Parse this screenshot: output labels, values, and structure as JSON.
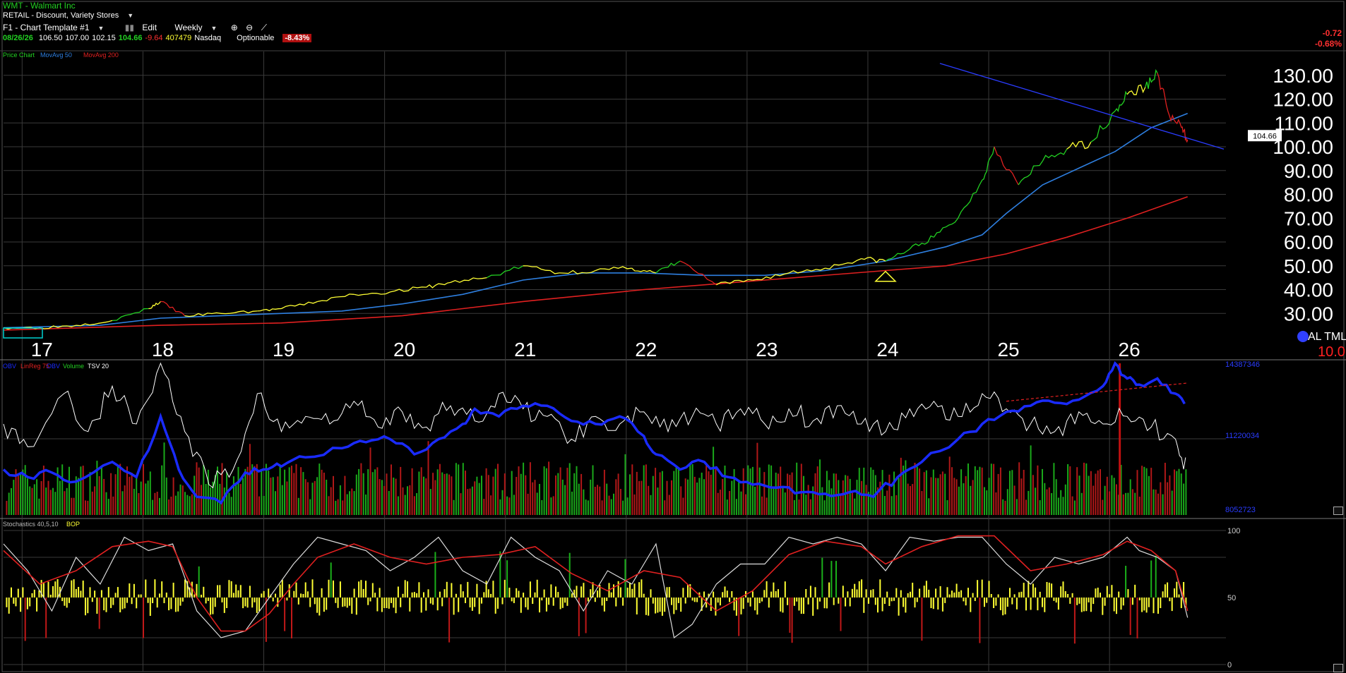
{
  "header": {
    "symbol_line": "WMT - Walmart Inc",
    "industry": "RETAIL - Discount, Variety Stores",
    "template": "F1 - Chart Template #1",
    "edit_label": "Edit",
    "period": "Weekly",
    "quote": {
      "date": "08/26/26",
      "open": "106.50",
      "high": "107.00",
      "low": "102.15",
      "close": "104.66",
      "change": "-9.64",
      "volume": "407479",
      "exchange": "Nasdaq",
      "optionable": "Optionable",
      "pct": "-8.43%"
    },
    "right_change": "-0.72",
    "right_pct": "-0.68%"
  },
  "colors": {
    "price_up": "#22d022",
    "price_down": "#e02020",
    "price_neutral": "#ffff33",
    "ma50": "#2e7fe0",
    "ma200": "#e02020",
    "obv": "#1a2bff",
    "tsv": "#ffffff",
    "stoch_k": "#dddddd",
    "stoch_d": "#e02020"
  },
  "chart_data": [
    {
      "type": "line",
      "panel": "price",
      "legend": [
        "Price Chart",
        "MovAvg 50",
        "MovAvg 200"
      ],
      "ylim": [
        20,
        140
      ],
      "yticks": [
        30,
        40,
        50,
        60,
        70,
        80,
        90,
        100,
        110,
        120,
        130
      ],
      "ytick_labels": [
        "30.00",
        "40.00",
        "50.00",
        "60.00",
        "70.00",
        "80.00",
        "90.00",
        "100.00",
        "110.00",
        "120.00",
        "130.00"
      ],
      "xlim": [
        2016.7,
        2026.8
      ],
      "xticks": [
        2017,
        2018,
        2019,
        2020,
        2021,
        2022,
        2023,
        2024,
        2025,
        2026
      ],
      "xtick_labels": [
        "17",
        "18",
        "19",
        "20",
        "21",
        "22",
        "23",
        "24",
        "25",
        "26"
      ],
      "last_price_label": "104.66",
      "corner_text": [
        "AL TML",
        "10.0"
      ],
      "price_series": {
        "x": [
          2016.7,
          2017.0,
          2017.3,
          2017.6,
          2017.9,
          2018.0,
          2018.2,
          2018.5,
          2018.8,
          2019.0,
          2019.3,
          2019.6,
          2019.9,
          2020.2,
          2020.4,
          2020.7,
          2021.0,
          2021.3,
          2021.6,
          2021.9,
          2022.1,
          2022.3,
          2022.6,
          2022.9,
          2023.2,
          2023.5,
          2023.8,
          2024.0,
          2024.2,
          2024.4,
          2024.6,
          2024.8,
          2024.9,
          2025.1,
          2025.3,
          2025.5,
          2025.7,
          2025.9,
          2026.0,
          2026.15,
          2026.25,
          2026.35,
          2026.45,
          2026.5
        ],
        "y": [
          24,
          24,
          25,
          27,
          32,
          35,
          29,
          30,
          31,
          32,
          35,
          38,
          39,
          41,
          43,
          45,
          50,
          47,
          48,
          49,
          47,
          52,
          42,
          44,
          47,
          49,
          53,
          52,
          57,
          62,
          70,
          86,
          100,
          84,
          94,
          99,
          102,
          115,
          122,
          125,
          131,
          113,
          108,
          103
        ]
      },
      "ma50": {
        "x": [
          2016.7,
          2017.5,
          2018.0,
          2018.5,
          2019.0,
          2019.5,
          2020.0,
          2020.5,
          2021.0,
          2021.5,
          2022.0,
          2022.5,
          2023.0,
          2023.5,
          2024.0,
          2024.5,
          2024.8,
          2025.0,
          2025.3,
          2025.6,
          2025.9,
          2026.2,
          2026.5
        ],
        "y": [
          24,
          25,
          28,
          29,
          30,
          31,
          34,
          38,
          44,
          47,
          47,
          46,
          46,
          48,
          52,
          58,
          63,
          72,
          84,
          91,
          98,
          108,
          114
        ]
      },
      "ma200": {
        "x": [
          2016.7,
          2018.0,
          2019.0,
          2020.0,
          2021.0,
          2022.0,
          2023.0,
          2024.0,
          2024.5,
          2025.0,
          2025.5,
          2026.0,
          2026.5
        ],
        "y": [
          23,
          25,
          26,
          29,
          35,
          40,
          44,
          48,
          50,
          55,
          62,
          70,
          79
        ]
      },
      "trendline": {
        "x": [
          2024.45,
          2026.8
        ],
        "y": [
          135,
          99
        ]
      },
      "annotation_triangle": {
        "x": 2024.0,
        "y": 43.5
      }
    },
    {
      "type": "line",
      "panel": "volume",
      "legend": [
        "OBV",
        "LinReg 75",
        "OBV",
        "Volume",
        "TSV 20"
      ],
      "ytick_labels": [
        "14387346",
        "11220034",
        "8052723"
      ],
      "xlim": [
        2016.7,
        2026.8
      ],
      "ylim": [
        0,
        100
      ],
      "obv": {
        "x": [
          2016.7,
          2016.9,
          2017.1,
          2017.3,
          2017.6,
          2017.8,
          2018.0,
          2018.15,
          2018.3,
          2018.5,
          2018.7,
          2018.85,
          2019.0,
          2019.2,
          2019.5,
          2019.7,
          2019.9,
          2020.1,
          2020.3,
          2020.5,
          2020.6,
          2020.8,
          2021.0,
          2021.2,
          2021.4,
          2021.6,
          2021.8,
          2022.0,
          2022.1,
          2022.3,
          2022.5,
          2022.7,
          2022.9,
          2023.1,
          2023.3,
          2023.5,
          2023.7,
          2023.9,
          2024.1,
          2024.3,
          2024.6,
          2024.8,
          2025.0,
          2025.2,
          2025.4,
          2025.6,
          2025.8,
          2025.9,
          2026.0,
          2026.1,
          2026.25,
          2026.4,
          2026.5
        ],
        "y": [
          30,
          25,
          28,
          22,
          35,
          25,
          65,
          30,
          12,
          8,
          28,
          30,
          32,
          38,
          44,
          48,
          50,
          40,
          50,
          60,
          70,
          65,
          72,
          72,
          62,
          60,
          65,
          52,
          40,
          30,
          35,
          25,
          20,
          18,
          15,
          14,
          15,
          12,
          25,
          35,
          50,
          60,
          68,
          72,
          74,
          76,
          85,
          100,
          90,
          86,
          90,
          80,
          70
        ]
      },
      "tsv": {
        "x": [
          2016.7,
          2016.9,
          2017.2,
          2017.4,
          2017.6,
          2017.8,
          2018.0,
          2018.2,
          2018.4,
          2018.6,
          2018.8,
          2019.0,
          2019.2,
          2019.4,
          2019.6,
          2019.8,
          2020.0,
          2020.2,
          2020.4,
          2020.6,
          2020.8,
          2021.0,
          2021.2,
          2021.4,
          2021.6,
          2021.8,
          2022.0,
          2022.2,
          2022.4,
          2022.6,
          2022.8,
          2023.0,
          2023.2,
          2023.4,
          2023.6,
          2023.8,
          2024.0,
          2024.2,
          2024.4,
          2024.6,
          2024.8,
          2025.0,
          2025.2,
          2025.4,
          2025.6,
          2025.8,
          2026.0,
          2026.2,
          2026.4,
          2026.5
        ],
        "y": [
          60,
          45,
          80,
          55,
          85,
          60,
          100,
          55,
          20,
          30,
          80,
          55,
          65,
          60,
          75,
          58,
          68,
          58,
          72,
          62,
          80,
          70,
          65,
          50,
          65,
          60,
          68,
          55,
          65,
          60,
          70,
          60,
          70,
          62,
          72,
          60,
          55,
          70,
          75,
          65,
          80,
          70,
          60,
          55,
          68,
          60,
          65,
          58,
          50,
          30
        ]
      },
      "linreg": {
        "x": [
          2025.0,
          2026.5
        ],
        "y": [
          75,
          87
        ]
      },
      "volume_bars": {
        "x_start": 2016.72,
        "x_end": 2026.5,
        "count": 510,
        "seed": 7
      }
    },
    {
      "type": "line",
      "panel": "stochastics",
      "legend": [
        "Stochastics 40,5,10",
        "BOP"
      ],
      "ylim": [
        0,
        100
      ],
      "ytick_labels": [
        "100",
        "50",
        "0"
      ],
      "xlim": [
        2016.7,
        2026.8
      ],
      "stoch_k": {
        "x": [
          2016.7,
          2016.9,
          2017.1,
          2017.3,
          2017.5,
          2017.7,
          2017.9,
          2018.1,
          2018.3,
          2018.5,
          2018.7,
          2018.9,
          2019.1,
          2019.3,
          2019.5,
          2019.7,
          2019.9,
          2020.1,
          2020.3,
          2020.5,
          2020.7,
          2020.9,
          2021.1,
          2021.3,
          2021.5,
          2021.7,
          2021.9,
          2022.1,
          2022.25,
          2022.4,
          2022.6,
          2022.8,
          2023.0,
          2023.2,
          2023.4,
          2023.6,
          2023.8,
          2024.0,
          2024.2,
          2024.4,
          2024.6,
          2024.8,
          2025.0,
          2025.2,
          2025.4,
          2025.6,
          2025.8,
          2026.0,
          2026.1,
          2026.25,
          2026.4,
          2026.5
        ],
        "y": [
          90,
          70,
          40,
          80,
          60,
          95,
          85,
          90,
          40,
          20,
          25,
          50,
          75,
          95,
          90,
          85,
          70,
          80,
          95,
          70,
          60,
          95,
          80,
          70,
          40,
          70,
          60,
          90,
          20,
          30,
          60,
          75,
          75,
          95,
          90,
          95,
          90,
          70,
          95,
          92,
          95,
          95,
          75,
          60,
          80,
          75,
          80,
          95,
          85,
          80,
          70,
          35
        ]
      },
      "stoch_d": {
        "x": [
          2016.7,
          2017.0,
          2017.3,
          2017.6,
          2017.9,
          2018.1,
          2018.3,
          2018.5,
          2018.7,
          2018.9,
          2019.1,
          2019.3,
          2019.6,
          2019.9,
          2020.2,
          2020.5,
          2020.8,
          2021.1,
          2021.4,
          2021.7,
          2022.0,
          2022.3,
          2022.6,
          2022.9,
          2023.2,
          2023.5,
          2023.8,
          2024.0,
          2024.3,
          2024.6,
          2024.9,
          2025.2,
          2025.5,
          2025.8,
          2026.0,
          2026.2,
          2026.4,
          2026.5
        ],
        "y": [
          85,
          60,
          70,
          88,
          92,
          88,
          50,
          25,
          25,
          38,
          60,
          80,
          90,
          80,
          75,
          80,
          82,
          88,
          68,
          55,
          70,
          65,
          40,
          55,
          82,
          92,
          88,
          75,
          88,
          96,
          96,
          70,
          75,
          82,
          92,
          85,
          70,
          40
        ]
      },
      "bop_bars": {
        "x_start": 2016.72,
        "x_end": 2026.5,
        "count": 510,
        "seed": 11
      }
    }
  ]
}
